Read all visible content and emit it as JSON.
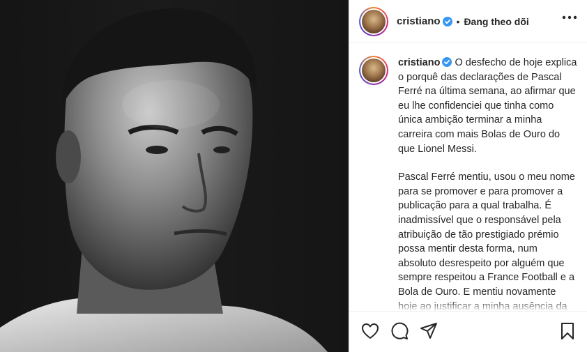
{
  "header": {
    "username": "cristiano",
    "separator": "•",
    "follow_status": "Đang theo dõi",
    "more_icon": "more-options-icon"
  },
  "caption": {
    "username": "cristiano",
    "paragraph1": "O desfecho de hoje explica o porquê das declarações de Pascal Ferré na última semana, ao afirmar que eu lhe confidenciei que tinha como única ambição terminar a minha carreira com mais Bolas de Ouro do que Lionel Messi.",
    "paragraph2": "Pascal Ferré mentiu, usou o meu nome para se promover e para promover a publicação para a qual trabalha. É inadmissível que o responsável pela atribuição de tão prestigiado prémio possa mentir desta forma, num absoluto desrespeito por alguém que sempre respeitou a France Football e a Bola de Ouro. E mentiu novamente hoje ao justificar a minha ausência da Gala com uma alegada quarentena que não"
  },
  "actions": {
    "like_icon": "heart-icon",
    "comment_icon": "comment-icon",
    "share_icon": "share-icon",
    "save_icon": "bookmark-icon"
  },
  "colors": {
    "verified_blue": "#3897f0",
    "text": "#262626",
    "divider": "#efefef"
  }
}
